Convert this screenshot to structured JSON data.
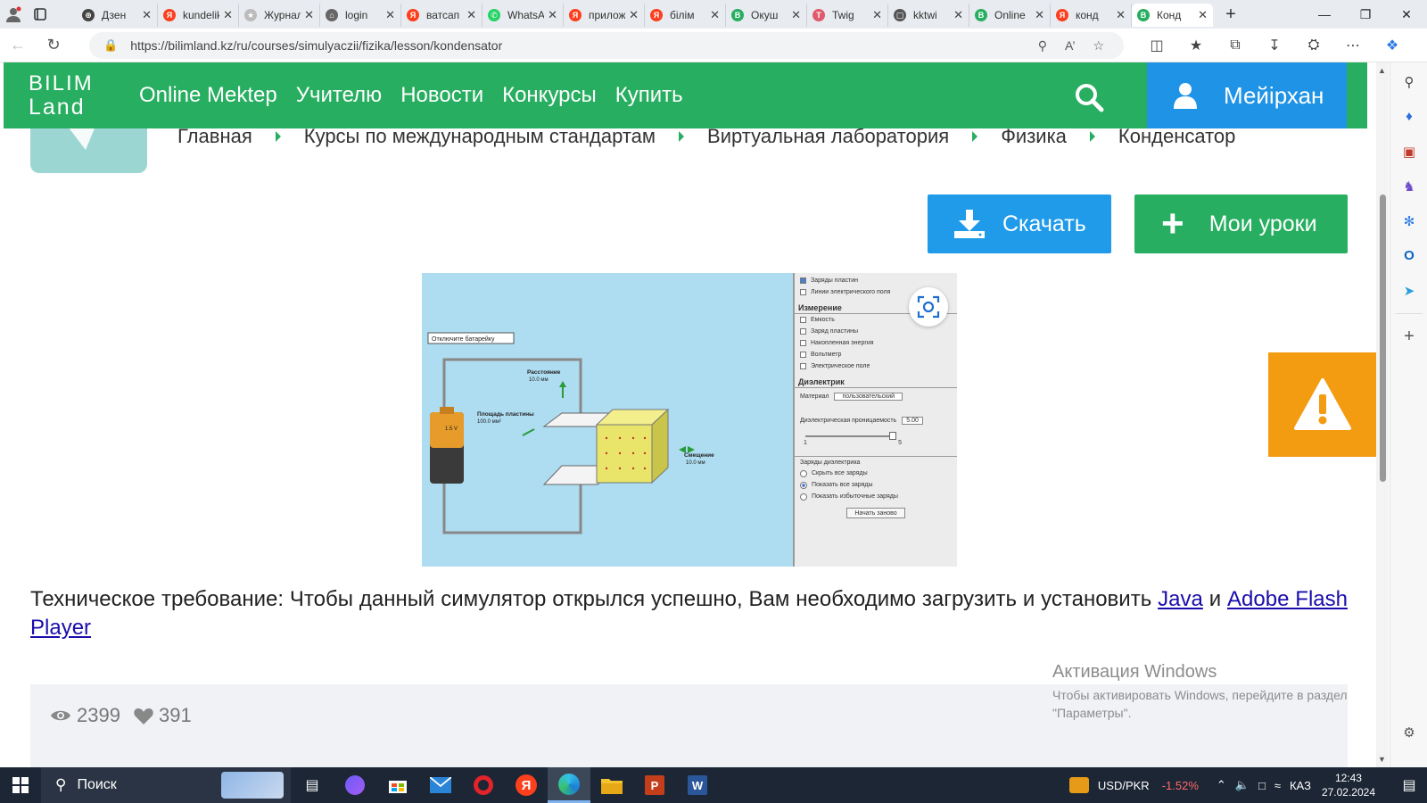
{
  "browser": {
    "tabs": [
      {
        "label": "Дзен",
        "favcolor": "#444444",
        "glyph": "⊕"
      },
      {
        "label": "kundelik",
        "favcolor": "#fc3f1d",
        "glyph": "Я"
      },
      {
        "label": "Журнал",
        "favcolor": "#bbbbbb",
        "glyph": "★"
      },
      {
        "label": "login",
        "favcolor": "#666666",
        "glyph": "⌂"
      },
      {
        "label": "ватсап",
        "favcolor": "#fc3f1d",
        "glyph": "Я"
      },
      {
        "label": "WhatsApp",
        "favcolor": "#25d366",
        "glyph": "✆"
      },
      {
        "label": "приложение",
        "favcolor": "#fc3f1d",
        "glyph": "Я"
      },
      {
        "label": "білім",
        "favcolor": "#fc3f1d",
        "glyph": "Я"
      },
      {
        "label": "Окуш",
        "favcolor": "#27ae60",
        "glyph": "B"
      },
      {
        "label": "Twig",
        "favcolor": "#e05a6d",
        "glyph": "T"
      },
      {
        "label": "kktwi",
        "favcolor": "#555555",
        "glyph": "▢"
      },
      {
        "label": "Online",
        "favcolor": "#27ae60",
        "glyph": "B"
      },
      {
        "label": "конд",
        "favcolor": "#fc3f1d",
        "glyph": "Я"
      },
      {
        "label": "Конд",
        "favcolor": "#27ae60",
        "glyph": "B"
      }
    ],
    "url": "https://bilimland.kz/ru/courses/simulyaczii/fizika/lesson/kondensator"
  },
  "site": {
    "logo_line1": "BILIM",
    "logo_line2": "Land",
    "menu": [
      "Online Mektep",
      "Учителю",
      "Новости",
      "Конкурсы",
      "Купить"
    ],
    "user_name": "Мейірхан"
  },
  "breadcrumb": [
    "Главная",
    "Курсы по международным стандартам",
    "Виртуальная лаборатория",
    "Физика",
    "Конденсатор"
  ],
  "actions": {
    "download": "Скачать",
    "my_lessons": "Мои уроки"
  },
  "simulator": {
    "disconnect_battery": "Отключите батарейку",
    "distance_label": "Расстояние",
    "distance_value": "10.0 мм",
    "area_label": "Площадь пластины",
    "area_value": "100.0 мм²",
    "offset_label": "Смещение",
    "offset_value": "10.0 мм",
    "battery_value": "1.5 V",
    "panel": {
      "top_items": [
        {
          "label": "Заряды пластин",
          "checked": true
        },
        {
          "label": "Линии электрического поля",
          "checked": false
        }
      ],
      "measure_header": "Измерение",
      "measure_items": [
        "Емкость",
        "Заряд пластины",
        "Накопленная энергия",
        "Вольтметр",
        "Электрическое поле"
      ],
      "dielectric_header": "Диэлектрик",
      "material_label": "Материал",
      "material_value": "пользовательский",
      "constant_label": "Диэлектрическая проницаемость",
      "constant_value": "5.00",
      "slider_min": "1",
      "slider_max": "5",
      "charges_header": "Заряды диэлектрика",
      "charge_options": [
        {
          "label": "Скрыть все заряды",
          "on": false
        },
        {
          "label": "Показать все заряды",
          "on": true
        },
        {
          "label": "Показать избыточные заряды",
          "on": false
        }
      ],
      "reset": "Начать заново"
    }
  },
  "notice": {
    "text": "Техническое требование: Чтобы данный симулятор открылся успешно, Вам необходимо загрузить и установить ",
    "link1": "Java",
    "conj": " и ",
    "link2": "Adobe Flash Player"
  },
  "stats": {
    "views": "2399",
    "likes": "391"
  },
  "activation": {
    "title": "Активация Windows",
    "body": "Чтобы активировать Windows, перейдите в раздел \"Параметры\"."
  },
  "taskbar": {
    "search": "Поиск",
    "currency_pair": "USD/PKR",
    "currency_change": "-1.52%",
    "lang": "КАЗ",
    "time": "12:43",
    "date": "27.02.2024"
  },
  "colors": {
    "brand_green": "#27ae60",
    "brand_blue": "#1f93e5",
    "warning_orange": "#f39c12"
  }
}
